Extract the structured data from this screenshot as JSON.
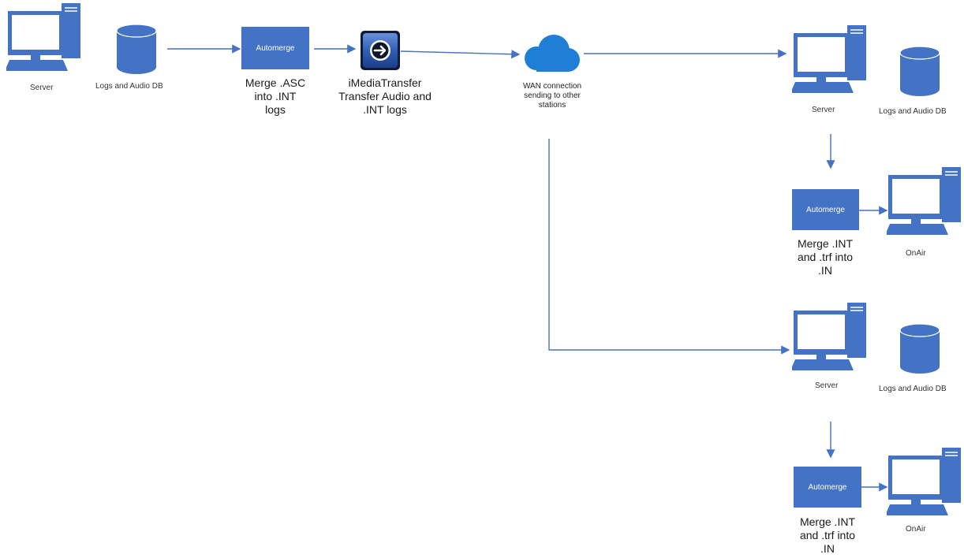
{
  "colors": {
    "primary": "#4472c4",
    "edge": "#4472c4",
    "background": "#ffffff"
  },
  "left": {
    "server_label": "Server",
    "db_label": "Logs and Audio DB",
    "automerge_label": "Automerge",
    "automerge_caption": [
      "Merge .ASC",
      "into .INT",
      "logs"
    ],
    "imedia_caption": [
      "iMediaTransfer",
      "Transfer Audio and",
      ".INT logs"
    ],
    "imedia_icon": "arrow-right-circle-icon"
  },
  "wan": {
    "icon": "cloud-icon",
    "caption": [
      "WAN connection",
      "sending to other",
      "stations"
    ]
  },
  "station1": {
    "server_label": "Server",
    "db_label": "Logs and Audio DB",
    "automerge_label": "Automerge",
    "automerge_caption": [
      "Merge .INT",
      "and .trf into",
      ".IN"
    ],
    "onair_label": "OnAir"
  },
  "station2": {
    "server_label": "Server",
    "db_label": "Logs and Audio DB",
    "automerge_label": "Automerge",
    "automerge_caption": [
      "Merge .INT",
      "and .trf into",
      ".IN"
    ],
    "onair_label": "OnAir"
  }
}
